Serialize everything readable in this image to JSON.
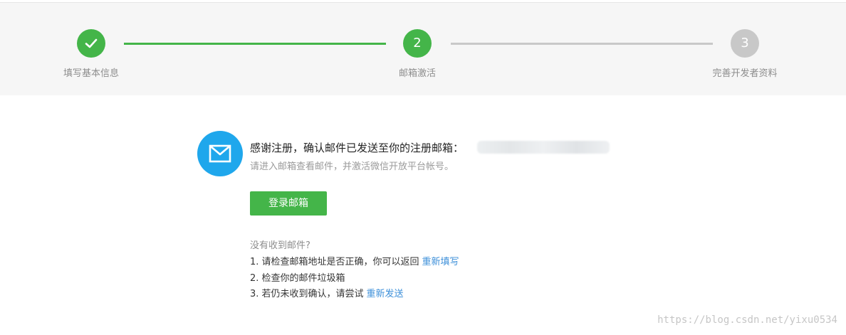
{
  "steps": [
    {
      "label": "填写基本信息",
      "state": "done",
      "number": ""
    },
    {
      "label": "邮箱激活",
      "state": "active",
      "number": "2"
    },
    {
      "label": "完善开发者资料",
      "state": "todo",
      "number": "3"
    }
  ],
  "main": {
    "thanks_text": "感谢注册，确认邮件已发送至你的注册邮箱：",
    "hint_text": "请进入邮箱查看邮件，并激活微信开放平台帐号。",
    "login_button": "登录邮箱",
    "icon": "mail-icon"
  },
  "faq": {
    "title": "没有收到邮件?",
    "item1_text": "1. 请检查邮箱地址是否正确，你可以返回",
    "item1_link": "重新填写",
    "item2_text": "2. 检查你的邮件垃圾箱",
    "item3_text": "3. 若仍未收到确认，请尝试",
    "item3_link": "重新发送"
  },
  "watermark": "https://blog.csdn.net/yixu0534",
  "colors": {
    "accent": "#44b549",
    "pending": "#c8c8c8",
    "mail_icon_bg": "#1fa7ec",
    "link": "#3c8fd9"
  }
}
